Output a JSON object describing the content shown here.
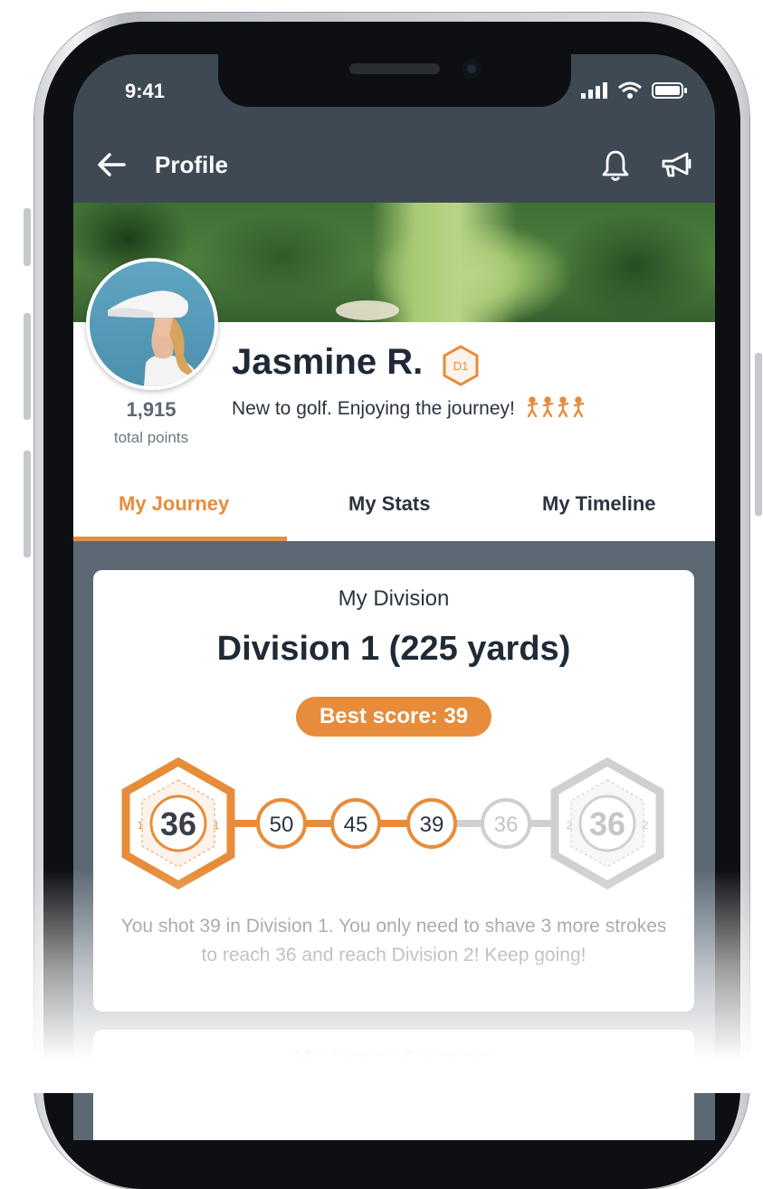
{
  "status_bar": {
    "time": "9:41"
  },
  "navbar": {
    "title": "Profile"
  },
  "profile": {
    "name": "Jasmine R.",
    "division_badge": "D1",
    "bio": "New to golf. Enjoying the journey!",
    "points": "1,915",
    "points_label": "total points"
  },
  "tabs": [
    {
      "label": "My Journey",
      "active": true
    },
    {
      "label": "My Stats",
      "active": false
    },
    {
      "label": "My Timeline",
      "active": false
    }
  ],
  "division_card": {
    "title": "My Division",
    "heading": "Division 1 (225 yards)",
    "best_score": "Best score: 39",
    "progress": {
      "start": {
        "value": "36",
        "division": "1"
      },
      "scores": [
        "50",
        "45",
        "39"
      ],
      "next": "36",
      "goal": {
        "value": "36",
        "division": "2"
      }
    },
    "summary": "You shot 39 in Division 1. You only need to shave 3 more strokes to reach 36 and reach Division 2! Keep going!"
  },
  "summary_card": {
    "title": "My August Summary"
  },
  "colors": {
    "accent": "#e78c3a",
    "header_bg": "#3e4954",
    "body_bg": "#5c6874",
    "inactive_node": "#cfcfcf"
  }
}
